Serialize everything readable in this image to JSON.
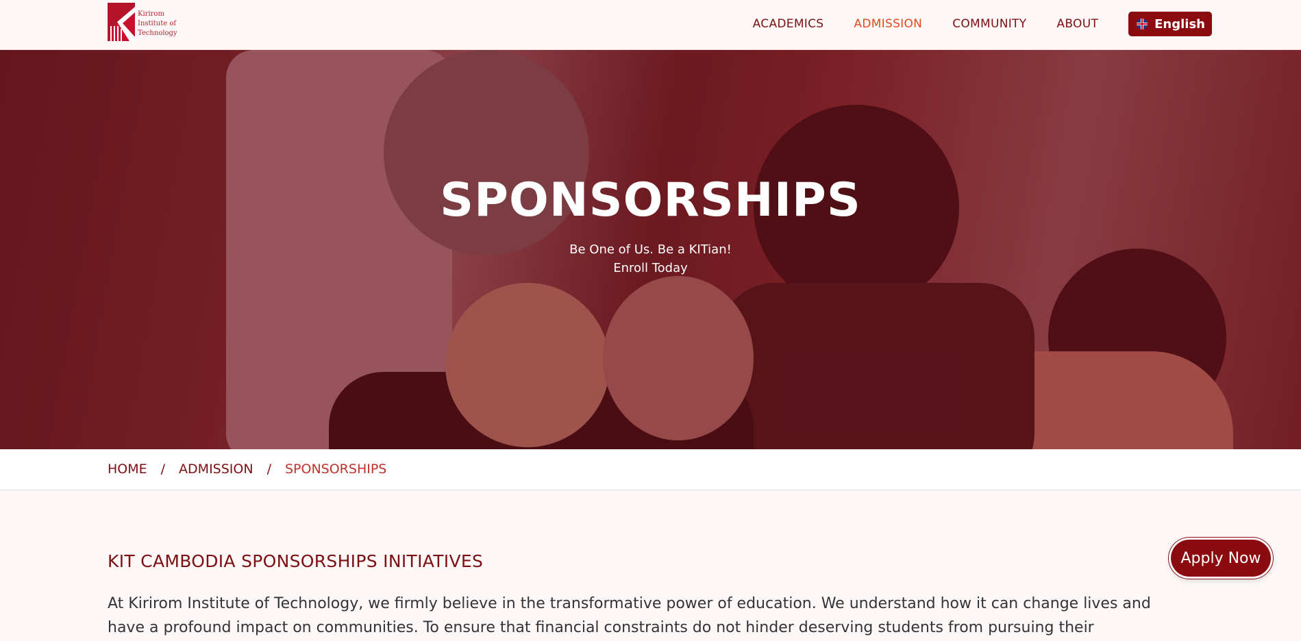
{
  "header": {
    "logo_text": "Kirirom Institute of Technology",
    "nav": [
      "ACADEMICS",
      "ADMISSION",
      "COMMUNITY",
      "ABOUT"
    ],
    "active_nav": "ADMISSION",
    "language_label": "English"
  },
  "hero": {
    "title": "SPONSORSHIPS",
    "subtitle_line1": "Be One of Us. Be a KITian!",
    "subtitle_line2": "Enroll Today"
  },
  "breadcrumb": {
    "items": [
      "HOME",
      "ADMISSION",
      "SPONSORSHIPS"
    ],
    "separator": "/"
  },
  "content": {
    "section_title": "KIT CAMBODIA SPONSORSHIPS INITIATIVES",
    "paragraph": "At Kirirom Institute of Technology, we firmly believe in the transformative power of education. We understand how it can change lives and have a profound impact on communities. To ensure that financial constraints do not hinder deserving students from pursuing their"
  },
  "cta": {
    "apply_label": "Apply Now"
  },
  "colors": {
    "brand": "#8b0c10",
    "accent": "#e04a1e",
    "hero_overlay": "#6e141c"
  }
}
